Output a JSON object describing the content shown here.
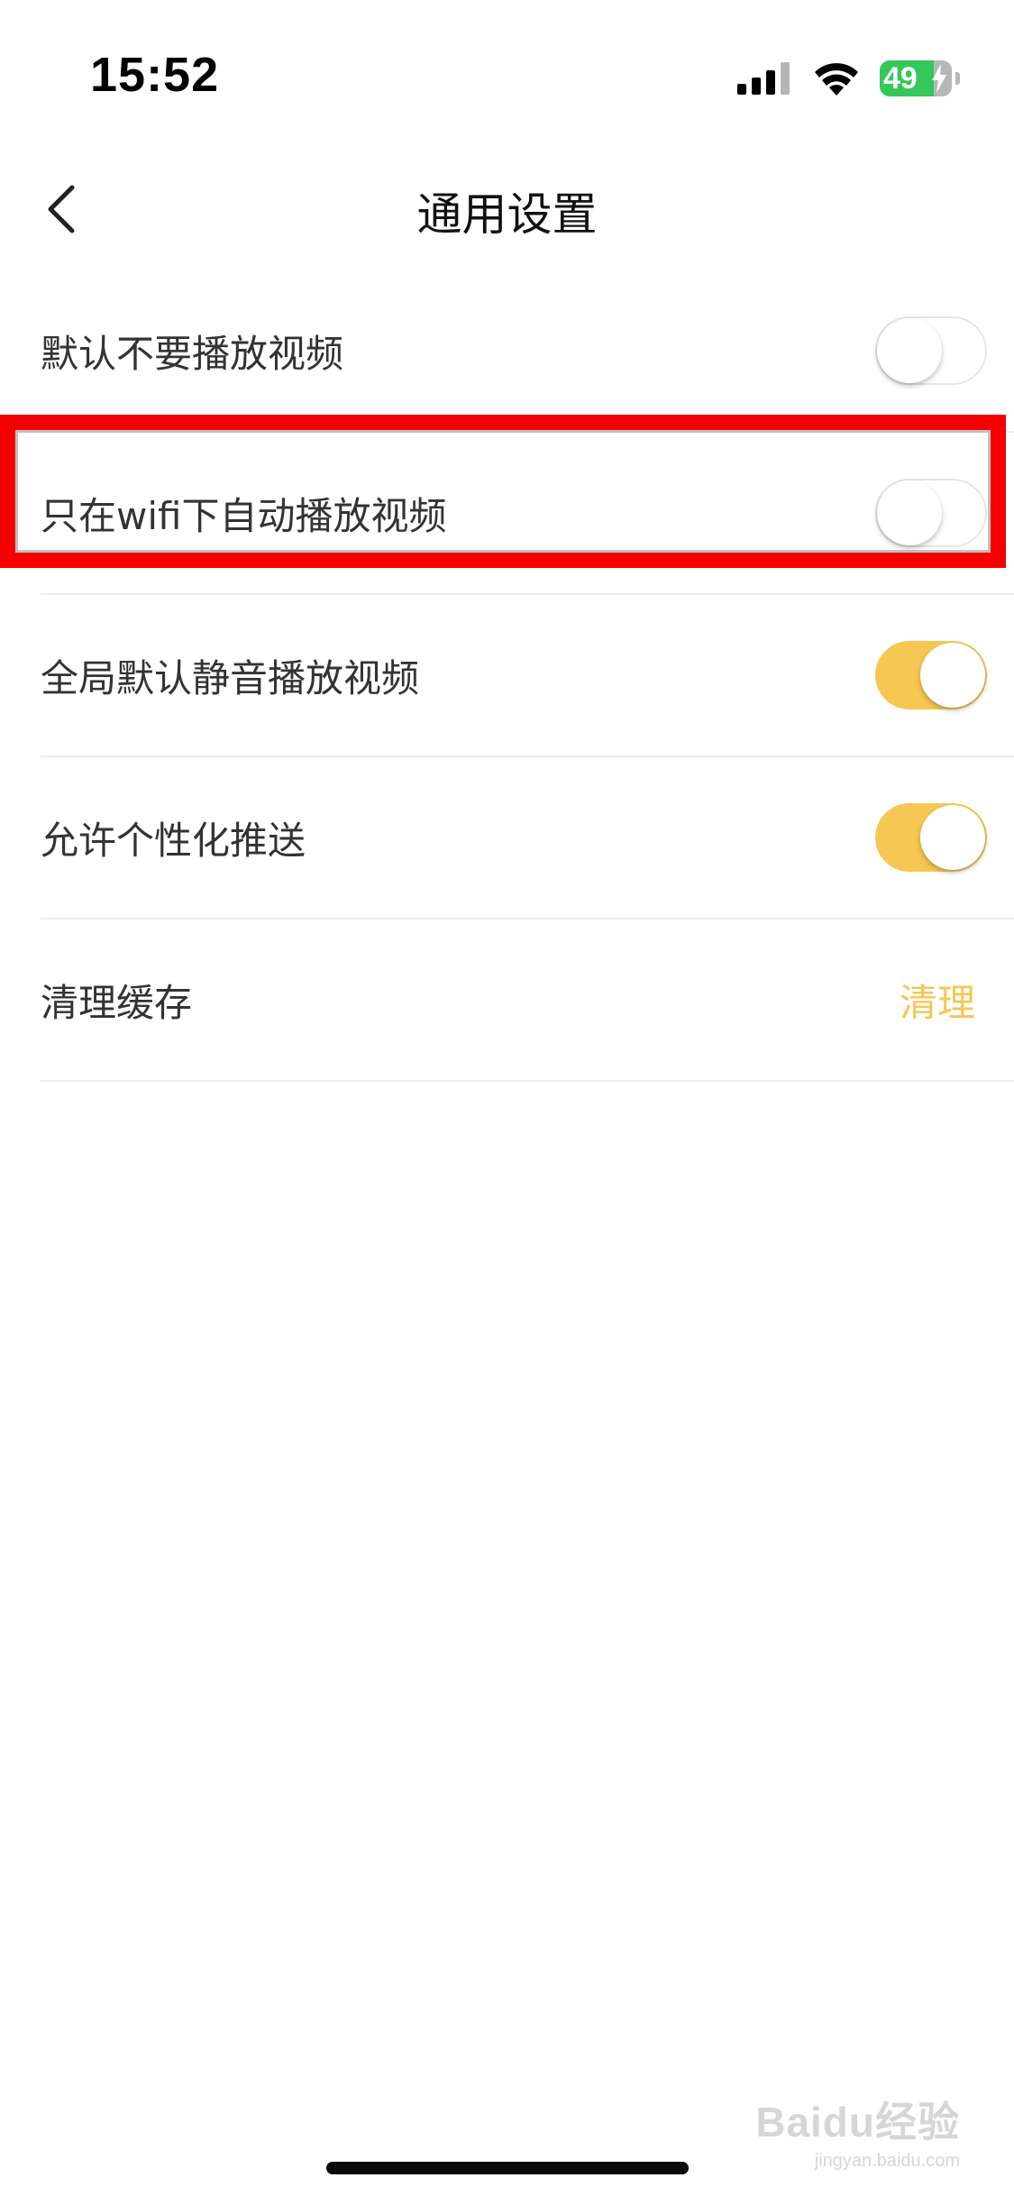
{
  "status_bar": {
    "time": "15:52",
    "battery_level": "49",
    "signal_icon": "cellular-signal-icon",
    "wifi_icon": "wifi-icon",
    "battery_icon": "battery-charging-icon",
    "battery_color": "#34c759"
  },
  "nav": {
    "back_icon": "chevron-left-icon",
    "title": "通用设置"
  },
  "settings": [
    {
      "label": "默认不要播放视频",
      "toggle_on": false
    },
    {
      "label": "只在wifi下自动播放视频",
      "toggle_on": false
    },
    {
      "label": "全局默认静音播放视频",
      "toggle_on": true
    },
    {
      "label": "允许个性化推送",
      "toggle_on": true
    }
  ],
  "cache": {
    "label": "清理缓存",
    "action_label": "清理"
  },
  "colors": {
    "accent": "#f6c753",
    "highlight": "#f40000"
  },
  "watermark": {
    "brand": "Baidu经验",
    "site": "jingyan.baidu.com"
  }
}
